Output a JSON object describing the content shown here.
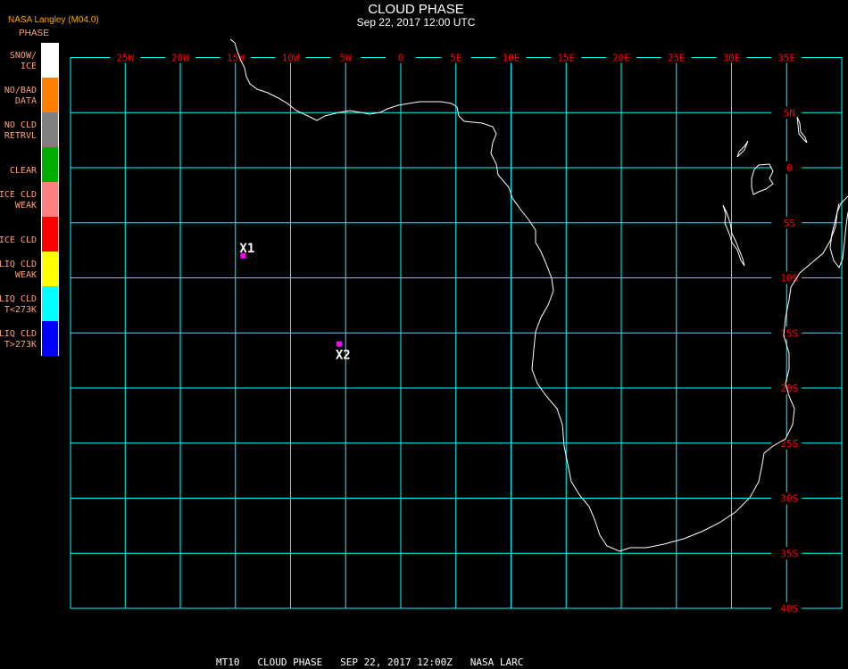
{
  "header": {
    "title": "CLOUD PHASE",
    "subtitle": "Sep 22, 2017 12:00 UTC",
    "source": "NASA Langley (M04.0)"
  },
  "legend": {
    "title": "PHASE",
    "items": [
      {
        "line1": "SNOW/",
        "line2": "ICE",
        "color": "#ffffff"
      },
      {
        "line1": "NO/BAD",
        "line2": "DATA",
        "color": "#ff8000"
      },
      {
        "line1": "NO CLD",
        "line2": "RETRVL",
        "color": "#808080"
      },
      {
        "line1": "",
        "line2": "CLEAR",
        "color": "#00b000"
      },
      {
        "line1": "ICE CLD",
        "line2": "WEAK",
        "color": "#ff8080"
      },
      {
        "line1": "",
        "line2": "ICE CLD",
        "color": "#ff0000"
      },
      {
        "line1": "LIQ CLD",
        "line2": "WEAK",
        "color": "#ffff00"
      },
      {
        "line1": "LIQ CLD",
        "line2": "T<273K",
        "color": "#00ffff"
      },
      {
        "line1": "LIQ CLD",
        "line2": "T>273K",
        "color": "#0000ff"
      }
    ]
  },
  "map": {
    "grid_color": "#00ffff",
    "label_color": "#ff0000",
    "lon_labels": [
      "25W",
      "20W",
      "15W",
      "10W",
      "5W",
      "0",
      "5E",
      "10E",
      "15E",
      "20E",
      "25E",
      "30E",
      "35E"
    ],
    "lon_values": [
      -25,
      -20,
      -15,
      -10,
      -5,
      0,
      5,
      10,
      15,
      20,
      25,
      30,
      35
    ],
    "lat_labels": [
      "5N",
      "0",
      "5S",
      "10S",
      "15S",
      "20S",
      "25S",
      "30S",
      "35S",
      "40S"
    ],
    "lat_values": [
      5,
      0,
      -5,
      -10,
      -15,
      -20,
      -25,
      -30,
      -35,
      -40
    ],
    "lon_range": [
      -30,
      40
    ],
    "lat_range": [
      -40,
      10
    ],
    "markers": [
      {
        "label": "X1",
        "lon": -14.3,
        "lat": -8.0,
        "color": "#ff00ff"
      },
      {
        "label": "X2",
        "lon": -5.6,
        "lat": -16.0,
        "color": "#ff00ff"
      }
    ]
  },
  "footer": {
    "caption": "MT10   CLOUD PHASE   SEP 22, 2017 12:00Z   NASA LARC"
  }
}
